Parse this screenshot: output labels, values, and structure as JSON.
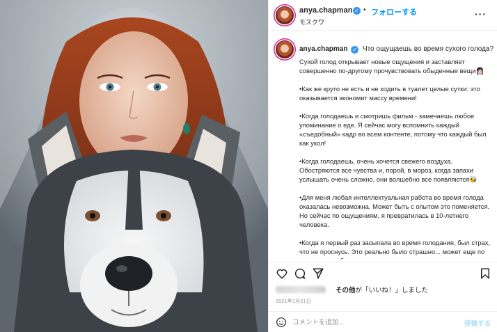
{
  "post": {
    "username": "anya.chapman",
    "separator": "•",
    "follow_label": "フォローする",
    "location": "モスクワ",
    "more_label": "···"
  },
  "caption": {
    "username": "anya.chapman",
    "first_line": "Что ощущаешь во время сухого голода?",
    "paragraphs": [
      "Сухой голод открывает новые ощущения и заставляет совершенно по-другому прочувствовать обыденные вещи👩🏻",
      "•Как же круто не есть и не ходить в туалет целые сутки: это оказывается экономит массу времени!",
      "•Когда голодаешь и смотришь фильм - замечаешь любое упоминание о еде. Я сейчас могу вспомнить каждый «съедобный» кадр во всем контенте, потому что каждый был как укол!",
      "•Когда голодаешь, очень хочется свежего воздуха. Обостряются все чувства и, порой, в мороз, когда запахи услышать очень сложно, они волшебно все появляются🐝",
      "•Для меня любая интеллектуальная работа во время голода оказалась невозможна. Может быть с опытом это поменяется. Но сейчас по ощущениям, я превратилась в 10-летнего человека.",
      "•Когда я первый раз засыпала во время голодания, был страх, что не проснусь. Это реально было страшно... может еще по этому сна не было."
    ]
  },
  "likes": {
    "others_label": "その他",
    "suffix": "が「いいね！」しました"
  },
  "date": "2021年1月21日",
  "comment": {
    "placeholder": "コメントを追加...",
    "post_label": "投稿する"
  },
  "icons": {
    "verified": "verified-badge-icon",
    "like": "heart-icon",
    "comment": "comment-icon",
    "share": "share-icon",
    "save": "bookmark-icon",
    "emoji": "emoji-icon",
    "more": "more-options-icon"
  },
  "colors": {
    "accent": "#0095f6",
    "verified": "#3897f0",
    "post_disabled": "#b2dffc",
    "meta_gray": "#8e8e8e"
  }
}
